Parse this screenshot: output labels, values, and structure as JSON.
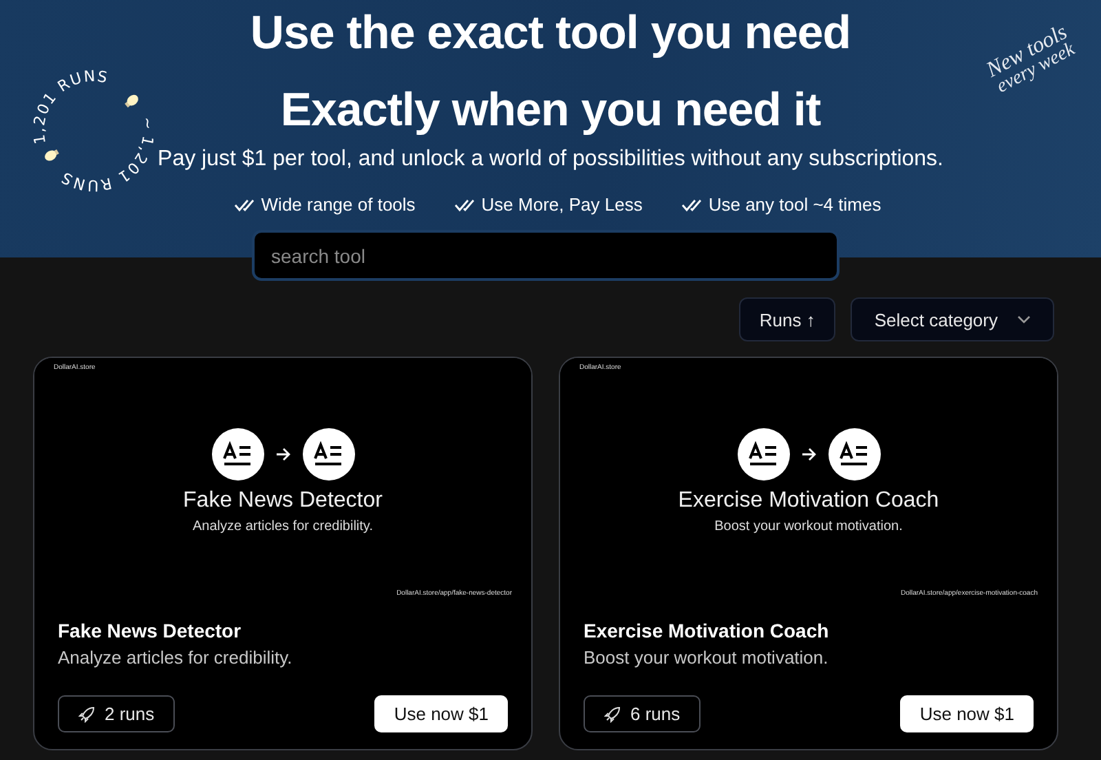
{
  "hero": {
    "headlines": [
      "Use the exact tool you need",
      "Exactly when you need it"
    ],
    "subtitle": "Pay just $1 per tool, and unlock a world of possibilities without any subscriptions.",
    "ring": {
      "texts": [
        "1,201 RUNS",
        "1,201 RUNS"
      ],
      "separator": "~"
    },
    "note": [
      "New tools",
      "every week"
    ],
    "features": [
      "Wide range of tools",
      "Use More, Pay Less",
      "Use any tool ~4 times"
    ]
  },
  "search": {
    "placeholder": "search tool"
  },
  "sort": {
    "label": "Runs",
    "arrow": "↑"
  },
  "category": {
    "label": "Select category"
  },
  "tools": [
    {
      "thumb": {
        "brand": "DollarAI.store",
        "title": "Fake News Detector",
        "subtitle": "Analyze articles for credibility.",
        "url": "DollarAI.store/app/fake-news-detector"
      },
      "title": "Fake News Detector",
      "description": "Analyze articles for credibility.",
      "runs": "2 runs",
      "action": "Use now $1"
    },
    {
      "thumb": {
        "brand": "DollarAI.store",
        "title": "Exercise Motivation Coach",
        "subtitle": "Boost your workout motivation.",
        "url": "DollarAI.store/app/exercise-motivation-coach"
      },
      "title": "Exercise Motivation Coach",
      "description": "Boost your workout motivation.",
      "runs": "6 runs",
      "action": "Use now $1"
    }
  ]
}
